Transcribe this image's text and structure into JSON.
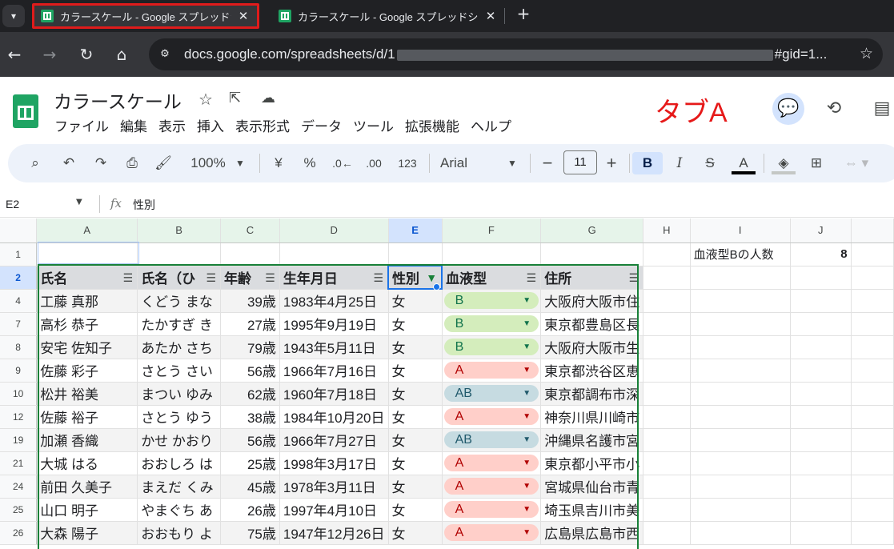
{
  "browser": {
    "tabs": [
      {
        "title": "カラースケール - Google スプレッドシ",
        "active": true
      },
      {
        "title": "カラースケール - Google スプレッドシ",
        "active": false
      }
    ],
    "url_visible_start": "docs.google.com/spreadsheets/d/1",
    "url_visible_end": "#gid=1..."
  },
  "doc": {
    "title": "カラースケール",
    "menus": [
      "ファイル",
      "編集",
      "表示",
      "挿入",
      "表示形式",
      "データ",
      "ツール",
      "拡張機能",
      "ヘルプ"
    ],
    "annotation": "タブA"
  },
  "toolbar": {
    "zoom": "100%",
    "currency": "¥",
    "percent": "%",
    "dec_less": ".0←",
    "dec_more": ".00",
    "format123": "123",
    "font": "Arial",
    "font_size": "11",
    "bold": "B",
    "italic": "I"
  },
  "formula": {
    "cell_ref": "E2",
    "fx": "fx",
    "value": "性別"
  },
  "columns": [
    "A",
    "B",
    "C",
    "D",
    "E",
    "F",
    "G",
    "H",
    "I",
    "J"
  ],
  "selected_column": "E",
  "side": {
    "label": "血液型Bの人数",
    "value": "8"
  },
  "headers": [
    "氏名",
    "氏名（ひ",
    "年齢",
    "生年月日",
    "性別",
    "血液型",
    "住所"
  ],
  "rows": [
    {
      "row": "4",
      "name": "工藤 真那",
      "kana": "くどう まな",
      "age": "39歳",
      "birth": "1983年4月25日",
      "sex": "女",
      "blood": "B",
      "addr": "大阪府大阪市住"
    },
    {
      "row": "7",
      "name": "高杉 恭子",
      "kana": "たかすぎ き",
      "age": "27歳",
      "birth": "1995年9月19日",
      "sex": "女",
      "blood": "B",
      "addr": "東京都豊島区長"
    },
    {
      "row": "8",
      "name": "安宅 佐知子",
      "kana": "あたか さち",
      "age": "79歳",
      "birth": "1943年5月11日",
      "sex": "女",
      "blood": "B",
      "addr": "大阪府大阪市生"
    },
    {
      "row": "9",
      "name": "佐藤 彩子",
      "kana": "さとう さい",
      "age": "56歳",
      "birth": "1966年7月16日",
      "sex": "女",
      "blood": "A",
      "addr": "東京都渋谷区恵"
    },
    {
      "row": "10",
      "name": "松井 裕美",
      "kana": "まつい ゆみ",
      "age": "62歳",
      "birth": "1960年7月18日",
      "sex": "女",
      "blood": "AB",
      "addr": "東京都調布市深"
    },
    {
      "row": "12",
      "name": "佐藤 裕子",
      "kana": "さとう ゆう",
      "age": "38歳",
      "birth": "1984年10月20日",
      "sex": "女",
      "blood": "A",
      "addr": "神奈川県川崎市"
    },
    {
      "row": "19",
      "name": "加瀬 香織",
      "kana": "かせ かおり",
      "age": "56歳",
      "birth": "1966年7月27日",
      "sex": "女",
      "blood": "AB",
      "addr": "沖縄県名護市宮"
    },
    {
      "row": "21",
      "name": "大城 はる",
      "kana": "おおしろ は",
      "age": "25歳",
      "birth": "1998年3月17日",
      "sex": "女",
      "blood": "A",
      "addr": "東京都小平市小"
    },
    {
      "row": "24",
      "name": "前田 久美子",
      "kana": "まえだ くみ",
      "age": "45歳",
      "birth": "1978年3月11日",
      "sex": "女",
      "blood": "A",
      "addr": "宮城県仙台市青"
    },
    {
      "row": "25",
      "name": "山口 明子",
      "kana": "やまぐち あ",
      "age": "26歳",
      "birth": "1997年4月10日",
      "sex": "女",
      "blood": "A",
      "addr": "埼玉県吉川市美"
    },
    {
      "row": "26",
      "name": "大森 陽子",
      "kana": "おおもり よ",
      "age": "75歳",
      "birth": "1947年12月26日",
      "sex": "女",
      "blood": "A",
      "addr": "広島県広島市西"
    }
  ]
}
